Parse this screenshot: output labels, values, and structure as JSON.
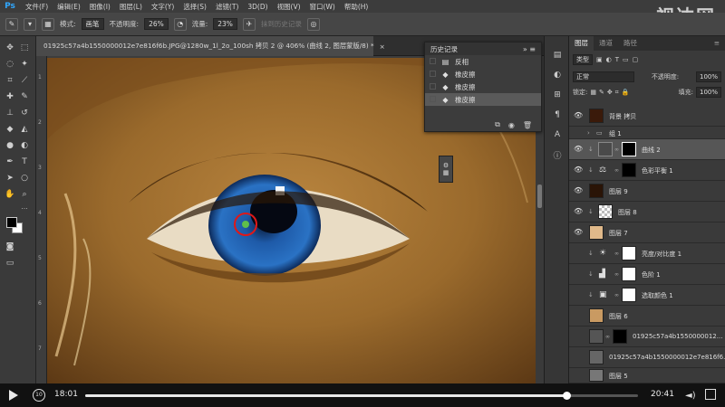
{
  "menubar": {
    "logo": "Ps",
    "items": [
      "文件(F)",
      "编辑(E)",
      "图像(I)",
      "图层(L)",
      "文字(Y)",
      "选择(S)",
      "滤镜(T)",
      "3D(D)",
      "视图(V)",
      "窗口(W)",
      "帮助(H)"
    ],
    "watermark": "视达网"
  },
  "options": {
    "mode_label": "模式:",
    "mode_value": "画笔",
    "opacity_label": "不透明度:",
    "opacity_value": "26%",
    "flow_label": "流量:",
    "flow_value": "23%",
    "erase_history": "抹到历史记录"
  },
  "document": {
    "tab_title": "01925c57a4b1550000012e7e816f6b.JPG@1280w_1l_2o_100sh 拷贝 2 @ 406% (曲线 2, 图层蒙版/8) *",
    "ruler_marks": [
      "1",
      "2",
      "3",
      "4",
      "5",
      "6",
      "7"
    ]
  },
  "history": {
    "title": "历史记录",
    "items": [
      {
        "label": "反相",
        "icon": "document-icon",
        "selected": false
      },
      {
        "label": "橡皮擦",
        "icon": "eraser-icon",
        "selected": false
      },
      {
        "label": "橡皮擦",
        "icon": "eraser-icon",
        "selected": false
      },
      {
        "label": "橡皮擦",
        "icon": "eraser-icon",
        "selected": true
      }
    ]
  },
  "layers_panel": {
    "tabs": [
      "图层",
      "通道",
      "路径"
    ],
    "filter_label": "类型",
    "blend_mode": "正常",
    "opacity_label": "不透明度:",
    "opacity_value": "100%",
    "lock_label": "锁定:",
    "fill_label": "填充:",
    "fill_value": "100%",
    "layers": [
      {
        "name": "背景 拷贝",
        "visible": true,
        "selected": false
      },
      {
        "name": "组 1",
        "visible": false,
        "selected": false
      },
      {
        "name": "曲线 2",
        "visible": true,
        "selected": true
      },
      {
        "name": "色彩平衡 1",
        "visible": true,
        "selected": false
      },
      {
        "name": "图层 9",
        "visible": true,
        "selected": false
      },
      {
        "name": "图层 8",
        "visible": true,
        "selected": false
      },
      {
        "name": "图层 7",
        "visible": true,
        "selected": false
      },
      {
        "name": "亮度/对比度 1",
        "visible": false,
        "selected": false
      },
      {
        "name": "色阶 1",
        "visible": false,
        "selected": false
      },
      {
        "name": "选取颜色 1",
        "visible": false,
        "selected": false
      },
      {
        "name": "图层 6",
        "visible": false,
        "selected": false
      },
      {
        "name": "01925c57a4b1550000012...",
        "visible": false,
        "selected": false
      },
      {
        "name": "01925c57a4b1550000012e7e816f6...",
        "visible": false,
        "selected": false
      },
      {
        "name": "图层 5",
        "visible": false,
        "selected": false
      }
    ]
  },
  "player": {
    "current_time": "18:01",
    "total_time": "20:41",
    "progress": 0.87
  }
}
